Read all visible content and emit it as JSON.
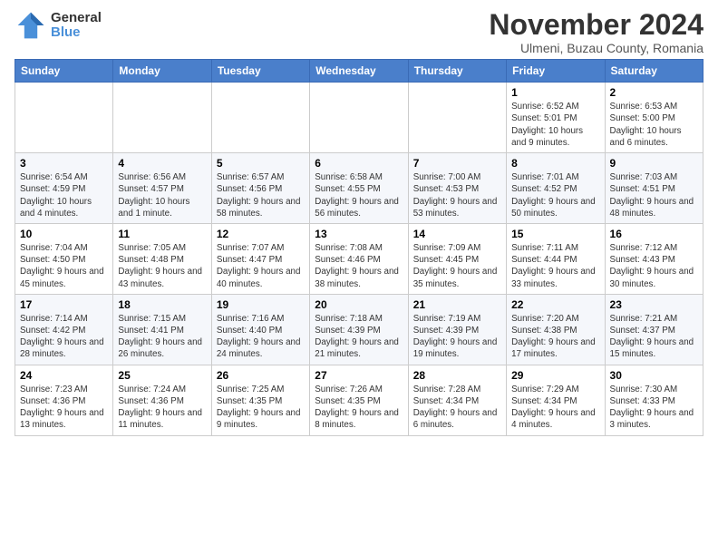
{
  "logo": {
    "general": "General",
    "blue": "Blue"
  },
  "title": "November 2024",
  "subtitle": "Ulmeni, Buzau County, Romania",
  "days_of_week": [
    "Sunday",
    "Monday",
    "Tuesday",
    "Wednesday",
    "Thursday",
    "Friday",
    "Saturday"
  ],
  "weeks": [
    [
      {
        "day": "",
        "info": ""
      },
      {
        "day": "",
        "info": ""
      },
      {
        "day": "",
        "info": ""
      },
      {
        "day": "",
        "info": ""
      },
      {
        "day": "",
        "info": ""
      },
      {
        "day": "1",
        "info": "Sunrise: 6:52 AM\nSunset: 5:01 PM\nDaylight: 10 hours and 9 minutes."
      },
      {
        "day": "2",
        "info": "Sunrise: 6:53 AM\nSunset: 5:00 PM\nDaylight: 10 hours and 6 minutes."
      }
    ],
    [
      {
        "day": "3",
        "info": "Sunrise: 6:54 AM\nSunset: 4:59 PM\nDaylight: 10 hours and 4 minutes."
      },
      {
        "day": "4",
        "info": "Sunrise: 6:56 AM\nSunset: 4:57 PM\nDaylight: 10 hours and 1 minute."
      },
      {
        "day": "5",
        "info": "Sunrise: 6:57 AM\nSunset: 4:56 PM\nDaylight: 9 hours and 58 minutes."
      },
      {
        "day": "6",
        "info": "Sunrise: 6:58 AM\nSunset: 4:55 PM\nDaylight: 9 hours and 56 minutes."
      },
      {
        "day": "7",
        "info": "Sunrise: 7:00 AM\nSunset: 4:53 PM\nDaylight: 9 hours and 53 minutes."
      },
      {
        "day": "8",
        "info": "Sunrise: 7:01 AM\nSunset: 4:52 PM\nDaylight: 9 hours and 50 minutes."
      },
      {
        "day": "9",
        "info": "Sunrise: 7:03 AM\nSunset: 4:51 PM\nDaylight: 9 hours and 48 minutes."
      }
    ],
    [
      {
        "day": "10",
        "info": "Sunrise: 7:04 AM\nSunset: 4:50 PM\nDaylight: 9 hours and 45 minutes."
      },
      {
        "day": "11",
        "info": "Sunrise: 7:05 AM\nSunset: 4:48 PM\nDaylight: 9 hours and 43 minutes."
      },
      {
        "day": "12",
        "info": "Sunrise: 7:07 AM\nSunset: 4:47 PM\nDaylight: 9 hours and 40 minutes."
      },
      {
        "day": "13",
        "info": "Sunrise: 7:08 AM\nSunset: 4:46 PM\nDaylight: 9 hours and 38 minutes."
      },
      {
        "day": "14",
        "info": "Sunrise: 7:09 AM\nSunset: 4:45 PM\nDaylight: 9 hours and 35 minutes."
      },
      {
        "day": "15",
        "info": "Sunrise: 7:11 AM\nSunset: 4:44 PM\nDaylight: 9 hours and 33 minutes."
      },
      {
        "day": "16",
        "info": "Sunrise: 7:12 AM\nSunset: 4:43 PM\nDaylight: 9 hours and 30 minutes."
      }
    ],
    [
      {
        "day": "17",
        "info": "Sunrise: 7:14 AM\nSunset: 4:42 PM\nDaylight: 9 hours and 28 minutes."
      },
      {
        "day": "18",
        "info": "Sunrise: 7:15 AM\nSunset: 4:41 PM\nDaylight: 9 hours and 26 minutes."
      },
      {
        "day": "19",
        "info": "Sunrise: 7:16 AM\nSunset: 4:40 PM\nDaylight: 9 hours and 24 minutes."
      },
      {
        "day": "20",
        "info": "Sunrise: 7:18 AM\nSunset: 4:39 PM\nDaylight: 9 hours and 21 minutes."
      },
      {
        "day": "21",
        "info": "Sunrise: 7:19 AM\nSunset: 4:39 PM\nDaylight: 9 hours and 19 minutes."
      },
      {
        "day": "22",
        "info": "Sunrise: 7:20 AM\nSunset: 4:38 PM\nDaylight: 9 hours and 17 minutes."
      },
      {
        "day": "23",
        "info": "Sunrise: 7:21 AM\nSunset: 4:37 PM\nDaylight: 9 hours and 15 minutes."
      }
    ],
    [
      {
        "day": "24",
        "info": "Sunrise: 7:23 AM\nSunset: 4:36 PM\nDaylight: 9 hours and 13 minutes."
      },
      {
        "day": "25",
        "info": "Sunrise: 7:24 AM\nSunset: 4:36 PM\nDaylight: 9 hours and 11 minutes."
      },
      {
        "day": "26",
        "info": "Sunrise: 7:25 AM\nSunset: 4:35 PM\nDaylight: 9 hours and 9 minutes."
      },
      {
        "day": "27",
        "info": "Sunrise: 7:26 AM\nSunset: 4:35 PM\nDaylight: 9 hours and 8 minutes."
      },
      {
        "day": "28",
        "info": "Sunrise: 7:28 AM\nSunset: 4:34 PM\nDaylight: 9 hours and 6 minutes."
      },
      {
        "day": "29",
        "info": "Sunrise: 7:29 AM\nSunset: 4:34 PM\nDaylight: 9 hours and 4 minutes."
      },
      {
        "day": "30",
        "info": "Sunrise: 7:30 AM\nSunset: 4:33 PM\nDaylight: 9 hours and 3 minutes."
      }
    ]
  ]
}
